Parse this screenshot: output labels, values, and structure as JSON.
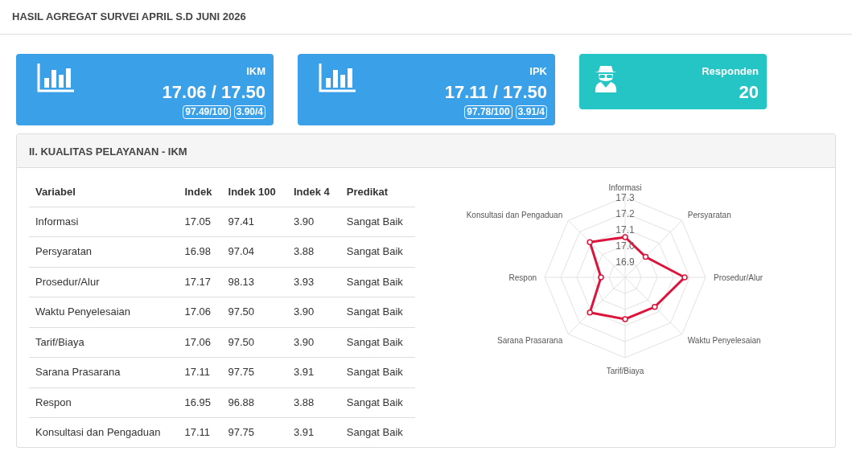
{
  "page_title": "HASIL AGREGAT SURVEI APRIL S.D JUNI 2026",
  "stat_cards": [
    {
      "kind": "index",
      "label": "IKM",
      "value": "17.06 / 17.50",
      "badges": [
        "97.49/100",
        "3.90/4"
      ]
    },
    {
      "kind": "index",
      "label": "IPK",
      "value": "17.11 / 17.50",
      "badges": [
        "97.78/100",
        "3.91/4"
      ]
    },
    {
      "kind": "count",
      "label": "Responden",
      "value": "20"
    }
  ],
  "panel": {
    "title": "II. KUALITAS PELAYANAN - IKM",
    "table": {
      "columns": [
        "Variabel",
        "Indek",
        "Indek 100",
        "Indek 4",
        "Predikat"
      ],
      "rows": [
        [
          "Informasi",
          "17.05",
          "97.41",
          "3.90",
          "Sangat Baik"
        ],
        [
          "Persyaratan",
          "16.98",
          "97.04",
          "3.88",
          "Sangat Baik"
        ],
        [
          "Prosedur/Alur",
          "17.17",
          "98.13",
          "3.93",
          "Sangat Baik"
        ],
        [
          "Waktu Penyelesaian",
          "17.06",
          "97.50",
          "3.90",
          "Sangat Baik"
        ],
        [
          "Tarif/Biaya",
          "17.06",
          "97.50",
          "3.90",
          "Sangat Baik"
        ],
        [
          "Sarana Prasarana",
          "17.11",
          "97.75",
          "3.91",
          "Sangat Baik"
        ],
        [
          "Respon",
          "16.95",
          "96.88",
          "3.88",
          "Sangat Baik"
        ],
        [
          "Konsultasi dan Pengaduan",
          "17.11",
          "97.75",
          "3.91",
          "Sangat Baik"
        ]
      ]
    },
    "chart_data": {
      "type": "radar",
      "categories": [
        "Informasi",
        "Persyaratan",
        "Prosedur/Alur",
        "Waktu Penyelesaian",
        "Tarif/Biaya",
        "Sarana Prasarana",
        "Respon",
        "Konsultasi dan Pengaduan"
      ],
      "series": [
        {
          "color": "#dc143c",
          "values": [
            17.05,
            16.98,
            17.17,
            17.06,
            17.06,
            17.11,
            16.95,
            17.11
          ]
        }
      ],
      "ylim": [
        16.8,
        17.3
      ],
      "yticks": [
        16.9,
        {
          "value": 17.0,
          "label": "17.0"
        },
        17.1,
        17.2,
        17.3
      ]
    }
  }
}
